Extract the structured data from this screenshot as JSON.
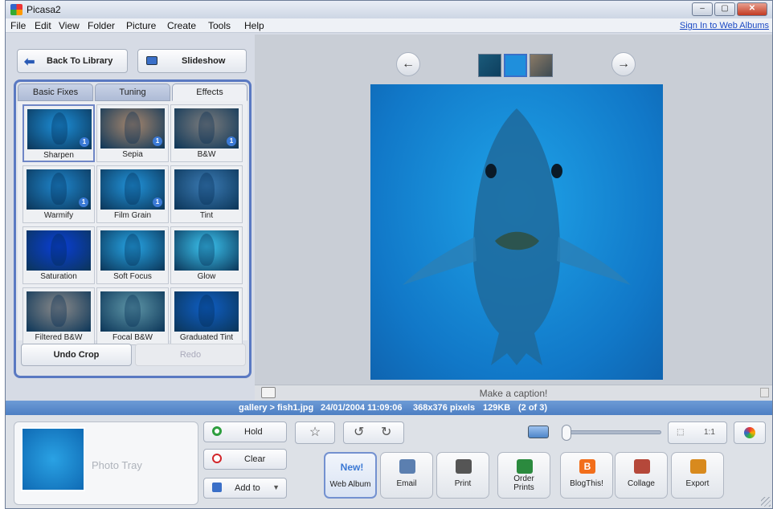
{
  "window": {
    "title": "Picasa2",
    "controls": [
      "–",
      "▢",
      "✕"
    ]
  },
  "menu": {
    "items": [
      "File",
      "Edit",
      "View",
      "Folder",
      "Picture",
      "Create",
      "Tools",
      "Help"
    ],
    "signin": "Sign In to Web Albums"
  },
  "left": {
    "back_label": "Back To Library",
    "slideshow_label": "Slideshow",
    "tabs": [
      "Basic Fixes",
      "Tuning",
      "Effects"
    ],
    "active_tab": "Effects",
    "effects": [
      {
        "label": "Sharpen",
        "badge": "1",
        "tint": "#1d8fd8"
      },
      {
        "label": "Sepia",
        "badge": "1",
        "tint": "#a8876d"
      },
      {
        "label": "B&W",
        "badge": "1",
        "tint": "#7d7d7d"
      },
      {
        "label": "Warmify",
        "badge": "1",
        "tint": "#1f86cc"
      },
      {
        "label": "Film Grain",
        "badge": "1",
        "tint": "#2295dc"
      },
      {
        "label": "Tint",
        "badge": "",
        "tint": "#3b7bb4"
      },
      {
        "label": "Saturation",
        "badge": "",
        "tint": "#0a3ed8"
      },
      {
        "label": "Soft Focus",
        "badge": "",
        "tint": "#27a6e6"
      },
      {
        "label": "Glow",
        "badge": "",
        "tint": "#3cc6f2"
      },
      {
        "label": "Filtered B&W",
        "badge": "",
        "tint": "#8a8a8a"
      },
      {
        "label": "Focal B&W",
        "badge": "",
        "tint": "#5f97a8"
      },
      {
        "label": "Graduated Tint",
        "badge": "",
        "tint": "#0f5fc6"
      }
    ],
    "undo_label": "Undo Crop",
    "redo_label": "Redo"
  },
  "viewer": {
    "prev_icon": "←",
    "next_icon": "→",
    "caption_placeholder": "Make a caption!"
  },
  "status": {
    "path": "gallery > fish1.jpg",
    "datetime": "24/01/2004 11:09:06",
    "dimensions": "368x376 pixels",
    "size": "129KB",
    "position": "(2 of 3)"
  },
  "tray": {
    "label": "Photo Tray",
    "hold_label": "Hold",
    "clear_label": "Clear",
    "addto_label": "Add to"
  },
  "toolbar": {
    "star_icon": "☆",
    "rotate_left_icon": "↺",
    "rotate_right_icon": "↻",
    "fit_label": "⬚",
    "actual_label": "1:1"
  },
  "actions": [
    {
      "label": "Web Album",
      "badge": "New!",
      "color": "#3a78d4"
    },
    {
      "label": "Email",
      "badge": "",
      "color": "#5b7fb0"
    },
    {
      "label": "Print",
      "badge": "",
      "color": "#555"
    },
    {
      "label": "Order Prints",
      "badge": "",
      "color": "#2b8a3e"
    },
    {
      "label": "BlogThis!",
      "badge": "B",
      "color": "#f26e1b"
    },
    {
      "label": "Collage",
      "badge": "",
      "color": "#b5483a"
    },
    {
      "label": "Export",
      "badge": "",
      "color": "#d88a1e"
    }
  ],
  "colors": {
    "accent": "#5a79c2",
    "status_bar": "#5a8ccf",
    "photo_blue": "#1178c8"
  }
}
